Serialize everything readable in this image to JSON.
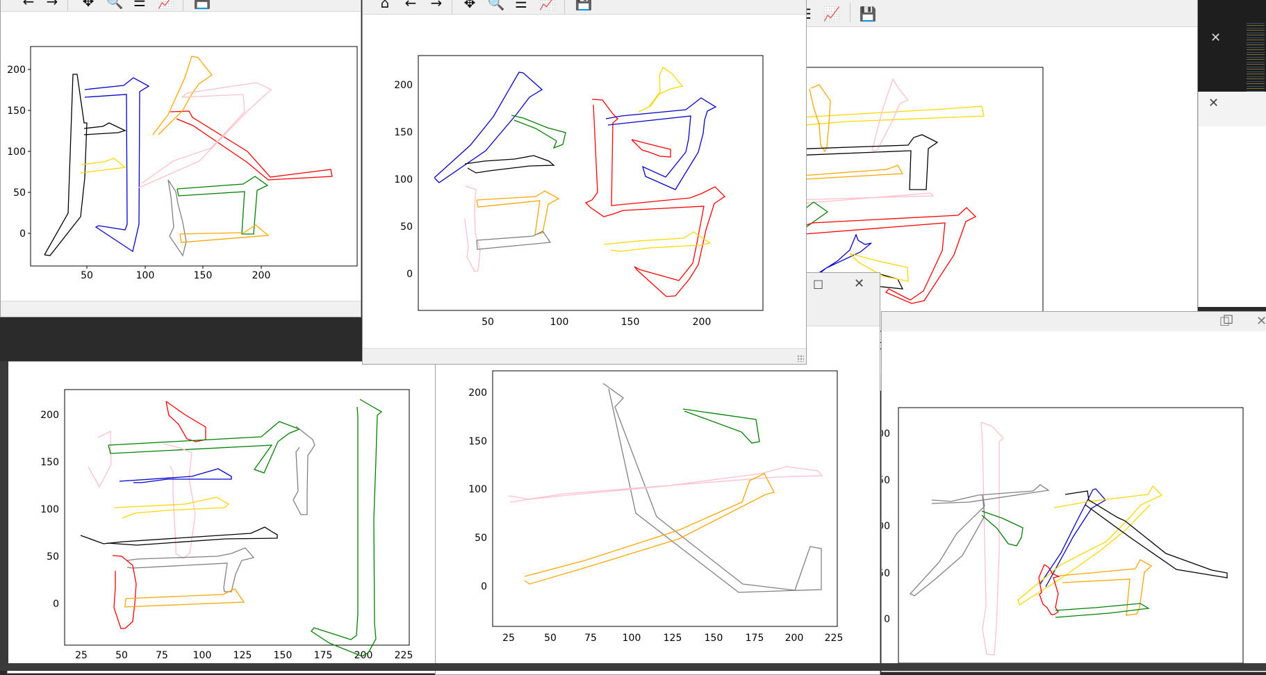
{
  "chart_data": [
    {
      "type": "scatter",
      "title": "",
      "xlabel": "",
      "ylabel": "",
      "xlim": [
        0,
        230
      ],
      "ylim": [
        -35,
        225
      ],
      "xticks": [
        "50",
        "100",
        "150",
        "200"
      ],
      "yticks": [
        "0",
        "50",
        "100",
        "150",
        "200"
      ],
      "series": [
        {
          "color": "#000000",
          "points": [
            [
              14,
              -25
            ],
            [
              60,
              195
            ],
            [
              65,
              190
            ],
            [
              60,
              -5
            ],
            [
              20,
              -30
            ]
          ]
        },
        {
          "color": "#0000cc",
          "points": [
            [
              48,
              172
            ],
            [
              80,
              178
            ],
            [
              90,
              190
            ],
            [
              100,
              180
            ],
            [
              90,
              175
            ],
            [
              88,
              5
            ],
            [
              78,
              -20
            ],
            [
              55,
              5
            ]
          ]
        },
        {
          "color": "#ffd700",
          "points": [
            [
              45,
              85
            ],
            [
              75,
              90
            ],
            [
              80,
              80
            ],
            [
              45,
              75
            ]
          ]
        },
        {
          "color": "#ff0000",
          "points": [
            [
              122,
              150
            ],
            [
              140,
              145
            ],
            [
              170,
              100
            ],
            [
              220,
              75
            ],
            [
              220,
              72
            ],
            [
              170,
              95
            ],
            [
              130,
              150
            ]
          ]
        },
        {
          "color": "#ffa500",
          "points": [
            [
              110,
              120
            ],
            [
              130,
              150
            ],
            [
              138,
              205
            ],
            [
              155,
              195
            ],
            [
              130,
              165
            ],
            [
              112,
              118
            ]
          ]
        },
        {
          "color": "#ffc0cb",
          "points": [
            [
              95,
              55
            ],
            [
              150,
              100
            ],
            [
              180,
              130
            ],
            [
              190,
              175
            ],
            [
              140,
              175
            ],
            [
              105,
              60
            ]
          ]
        },
        {
          "color": "#808080",
          "points": [
            [
              122,
              60
            ],
            [
              130,
              50
            ],
            [
              135,
              10
            ],
            [
              130,
              -28
            ],
            [
              120,
              0
            ],
            [
              125,
              60
            ]
          ]
        },
        {
          "color": "#008000",
          "points": [
            [
              130,
              55
            ],
            [
              180,
              60
            ],
            [
              190,
              65
            ],
            [
              185,
              50
            ],
            [
              180,
              0
            ],
            [
              170,
              0
            ],
            [
              175,
              50
            ],
            [
              130,
              50
            ]
          ]
        },
        {
          "color": "#ffa500",
          "points": [
            [
              130,
              -10
            ],
            [
              200,
              -5
            ],
            [
              190,
              10
            ],
            [
              130,
              5
            ]
          ]
        }
      ]
    },
    {
      "type": "scatter",
      "title": "",
      "xlabel": "",
      "ylabel": "",
      "xlim": [
        0,
        240
      ],
      "ylim": [
        -40,
        230
      ],
      "xticks": [
        "50",
        "100",
        "150",
        "200"
      ],
      "yticks": [
        "0",
        "50",
        "100",
        "150",
        "200"
      ],
      "series": [
        {
          "color": "#0000cc",
          "points": [
            [
              12,
              95
            ],
            [
              40,
              130
            ],
            [
              70,
              170
            ],
            [
              75,
              210
            ],
            [
              90,
              190
            ],
            [
              75,
              170
            ],
            [
              50,
              130
            ],
            [
              15,
              100
            ]
          ]
        },
        {
          "color": "#008000",
          "points": [
            [
              65,
              170
            ],
            [
              110,
              150
            ],
            [
              105,
              130
            ],
            [
              85,
              155
            ],
            [
              68,
              165
            ]
          ]
        },
        {
          "color": "#000000",
          "points": [
            [
              32,
              115
            ],
            [
              85,
              125
            ],
            [
              105,
              115
            ],
            [
              55,
              108
            ],
            [
              35,
              112
            ]
          ]
        },
        {
          "color": "#ffc0cb",
          "points": [
            [
              30,
              90
            ],
            [
              35,
              80
            ],
            [
              40,
              30
            ],
            [
              30,
              5
            ],
            [
              25,
              30
            ],
            [
              30,
              90
            ]
          ]
        },
        {
          "color": "#ffa500",
          "points": [
            [
              40,
              80
            ],
            [
              95,
              85
            ],
            [
              105,
              80
            ],
            [
              95,
              70
            ],
            [
              90,
              35
            ],
            [
              80,
              40
            ],
            [
              85,
              75
            ],
            [
              40,
              70
            ]
          ]
        },
        {
          "color": "#808080",
          "points": [
            [
              40,
              40
            ],
            [
              95,
              45
            ],
            [
              100,
              35
            ],
            [
              45,
              25
            ]
          ]
        },
        {
          "color": "#ff0000",
          "points": [
            [
              120,
              180
            ],
            [
              125,
              150
            ],
            [
              120,
              70
            ],
            [
              130,
              60
            ],
            [
              200,
              80
            ],
            [
              215,
              90
            ],
            [
              225,
              80
            ],
            [
              210,
              60
            ],
            [
              200,
              5
            ],
            [
              190,
              -30
            ],
            [
              160,
              5
            ],
            [
              175,
              10
            ],
            [
              205,
              70
            ],
            [
              130,
              70
            ],
            [
              130,
              170
            ]
          ]
        },
        {
          "color": "#0000cc",
          "points": [
            [
              130,
              165
            ],
            [
              170,
              170
            ],
            [
              185,
              180
            ],
            [
              195,
              170
            ],
            [
              185,
              155
            ],
            [
              180,
              100
            ],
            [
              170,
              85
            ],
            [
              155,
              110
            ],
            [
              175,
              145
            ],
            [
              135,
              150
            ]
          ]
        },
        {
          "color": "#ff0000",
          "points": [
            [
              155,
              135
            ],
            [
              180,
              130
            ],
            [
              175,
              120
            ],
            [
              165,
              125
            ],
            [
              155,
              132
            ]
          ]
        },
        {
          "color": "#ffd700",
          "points": [
            [
              145,
              165
            ],
            [
              160,
              210
            ],
            [
              170,
              190
            ],
            [
              155,
              160
            ]
          ]
        },
        {
          "color": "#ffd700",
          "points": [
            [
              105,
              30
            ],
            [
              185,
              40
            ],
            [
              195,
              35
            ],
            [
              180,
              25
            ],
            [
              120,
              20
            ]
          ]
        }
      ]
    }
  ],
  "window_controls": {
    "restore": "□",
    "close": "✕"
  }
}
